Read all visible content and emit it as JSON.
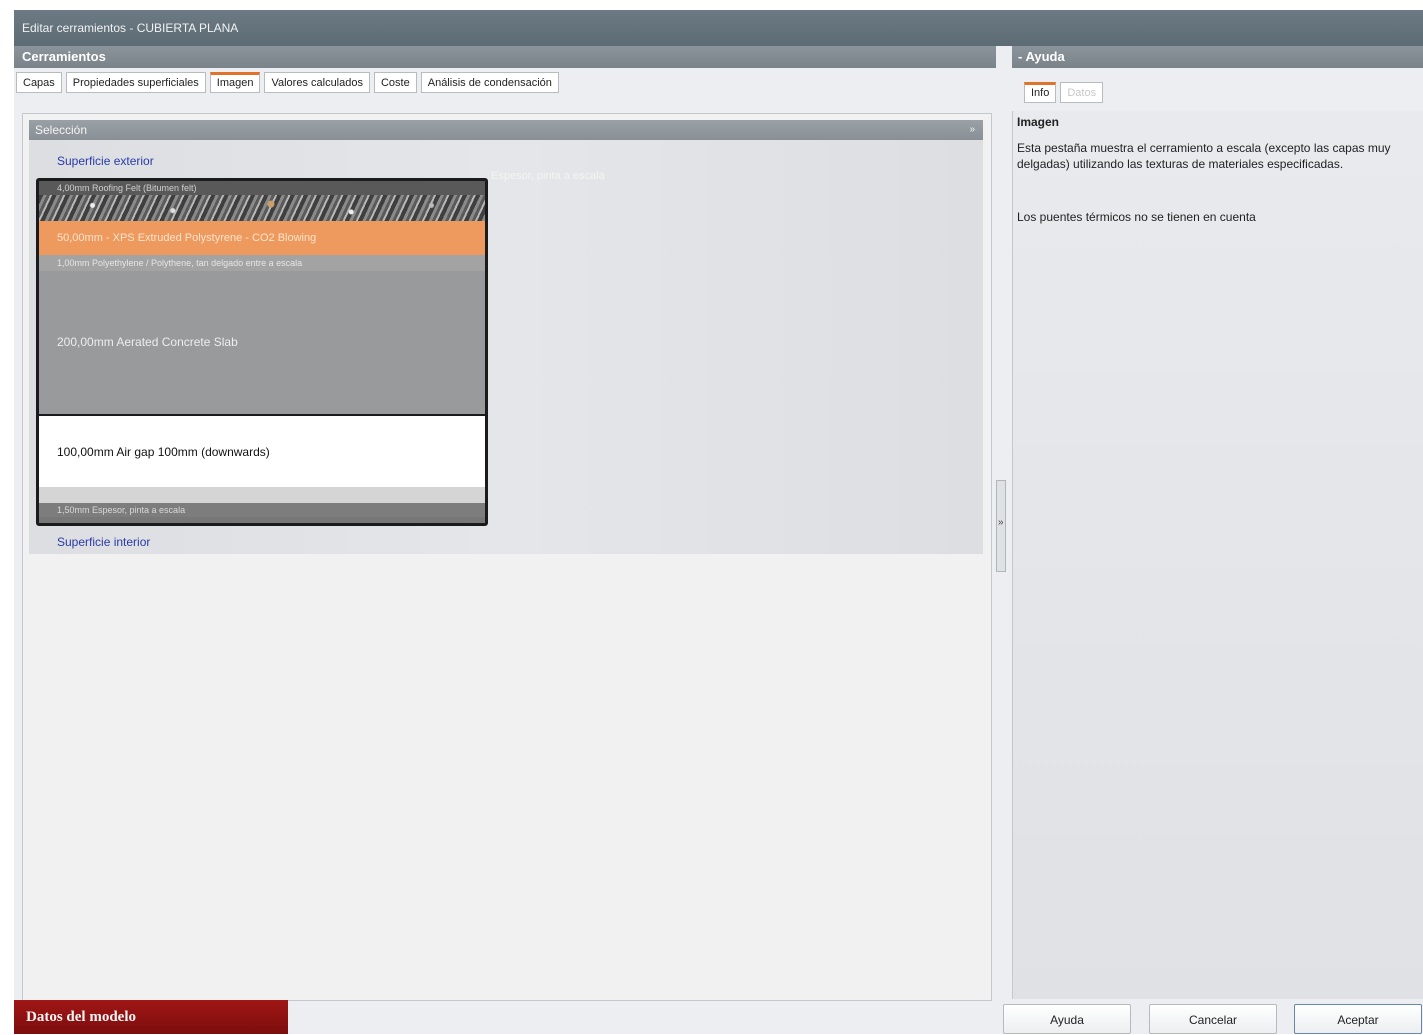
{
  "window": {
    "title": "Editar cerramientos - CUBIERTA PLANA"
  },
  "left_panel": {
    "header": "Cerramientos",
    "tabs": [
      {
        "label": "Capas",
        "active": false
      },
      {
        "label": "Propiedades superficiales",
        "active": false
      },
      {
        "label": "Imagen",
        "active": true
      },
      {
        "label": "Valores calculados",
        "active": false
      },
      {
        "label": "Coste",
        "active": false
      },
      {
        "label": "Análisis de condensación",
        "active": false
      }
    ],
    "section_title": "Selección",
    "section_chevron": "»",
    "exterior_label": "Superficie exterior",
    "interior_label": "Superficie interior",
    "side_note": "Espesor, pinta a escala"
  },
  "layers": [
    {
      "text": "4,00mm    Roofing Felt (Bitumen felt)"
    },
    {
      "text": ""
    },
    {
      "text": "50,00mm - XPS Extruded Polystyrene - CO2 Blowing"
    },
    {
      "text": "1,00mm    Polyethylene / Polythene, tan delgado entre a escala"
    },
    {
      "text": "200,00mm Aerated Concrete Slab"
    },
    {
      "text": "100,00mm Air gap 100mm (downwards)"
    },
    {
      "text": ""
    },
    {
      "text": "1,50mm    Espesor, pinta a escala"
    }
  ],
  "splitter": {
    "glyph": "»"
  },
  "right_panel": {
    "header": "- Ayuda",
    "tabs": [
      {
        "label": "Info",
        "active": true
      },
      {
        "label": "Datos",
        "active": false
      }
    ],
    "title": "Imagen",
    "paragraph1": "Esta pestaña muestra el cerramiento a escala (excepto las capas muy delgadas) utilizando las texturas de materiales especificadas.",
    "paragraph2": "Los puentes térmicos no se tienen en cuenta"
  },
  "footer": {
    "model_button": "Datos del modelo",
    "help": "Ayuda",
    "cancel": "Cancelar",
    "accept": "Aceptar"
  },
  "colors": {
    "accent_tab": "#e0722c",
    "model_button": "#8b1111",
    "insulation_layer": "#ee9a5e"
  }
}
